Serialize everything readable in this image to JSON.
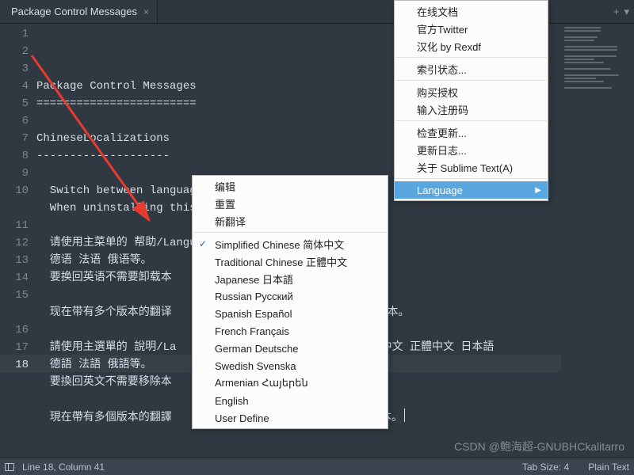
{
  "tab": {
    "title": "Package Control Messages"
  },
  "gutter": {
    "lines": [
      "1",
      "2",
      "3",
      "4",
      "5",
      "6",
      "7",
      "8",
      "9",
      "10",
      "11",
      "12",
      "13",
      "14",
      "15",
      "16",
      "17",
      "18"
    ],
    "current": 18
  },
  "editor": {
    "lines": [
      "Package Control Messages",
      "========================",
      "",
      "ChineseLocalizations",
      "--------------------",
      "",
      "  Switch between language in Main Menu Help/Language.",
      "  When uninstalling this plugin, it will switch back",
      "",
      "  请使用主菜单的 帮助/Language 子菜单来切换语言。目前支",
      "  德语 法语 俄语等。",
      "  要换回英语不需要卸载本",
      "",
      "  现在带有多个版本的翻译                             个版本。",
      "",
      "  請使用主選單的 說明/La                          ꣎ 簡體中文 正體中文 日本語",
      "  德語 法語 俄語等。",
      "  要換回英文不需要移除本",
      "",
      "  現在帶有多個版本的翻譯                            個版本。"
    ]
  },
  "help_menu": {
    "items_top": [
      "在线文档",
      "官方Twitter",
      "汉化 by Rexdf"
    ],
    "items_mid1": [
      "索引状态..."
    ],
    "items_mid2": [
      "购买授权",
      "输入注册码"
    ],
    "items_mid3": [
      "检查更新...",
      "更新日志...",
      "关于 Sublime Text(A)"
    ],
    "language_label": "Language"
  },
  "lang_menu": {
    "top": [
      "编辑",
      "重置",
      "新翻译"
    ],
    "langs": [
      {
        "label": "Simplified Chinese 简体中文",
        "checked": true
      },
      {
        "label": "Traditional Chinese 正體中文",
        "checked": false
      },
      {
        "label": "Japanese 日本語",
        "checked": false
      },
      {
        "label": "Russian Русский",
        "checked": false
      },
      {
        "label": "Spanish Español",
        "checked": false
      },
      {
        "label": "French Français",
        "checked": false
      },
      {
        "label": "German Deutsche",
        "checked": false
      },
      {
        "label": "Swedish Svenska",
        "checked": false
      },
      {
        "label": "Armenian Հայերեն",
        "checked": false
      },
      {
        "label": "English",
        "checked": false
      },
      {
        "label": "User Define",
        "checked": false
      }
    ]
  },
  "status": {
    "position": "Line 18, Column 41",
    "tab_size": "Tab Size: 4",
    "syntax": "Plain Text"
  },
  "watermark": "CSDN @鲍海超-GNUBHCkalitarro",
  "icons": {
    "add": "+",
    "dropdown": "▾",
    "close": "×",
    "caret_left": "◀"
  }
}
